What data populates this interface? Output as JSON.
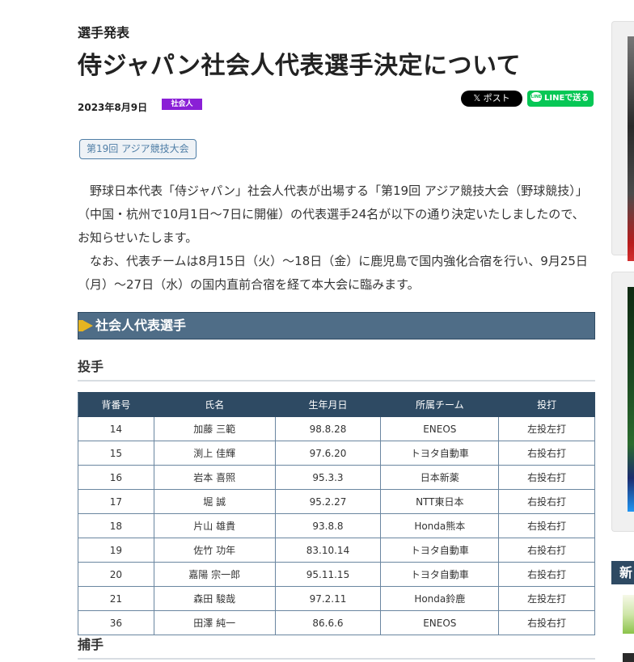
{
  "article": {
    "kicker": "選手発表",
    "title": "侍ジャパン社会人代表選手決定について",
    "date": "2023年8月9日",
    "category_badge": "社会人",
    "tag": "第19回 アジア競技大会",
    "paragraphs": [
      "野球日本代表「侍ジャパン」社会人代表が出場する「第19回 アジア競技大会（野球競技）」（中国・杭州で10月1日～7日に開催）の代表選手24名が以下の通り決定いたしましたので、お知らせいたします。",
      "なお、代表チームは8月15日（火）～18日（金）に鹿児島で国内強化合宿を行い、9月25日（月）～27日（水）の国内直前合宿を経て本大会に臨みます。"
    ]
  },
  "share": {
    "x_label": "𝕏 ポスト",
    "line_label": "LINEで送る",
    "line_bubble": "LINE"
  },
  "section": {
    "title": "社会人代表選手",
    "pitchers_heading": "投手",
    "catchers_heading": "捕手"
  },
  "table": {
    "headers": [
      "背番号",
      "氏名",
      "生年月日",
      "所属チーム",
      "投打"
    ],
    "rows": [
      [
        "14",
        "加藤 三範",
        "98.8.28",
        "ENEOS",
        "左投左打"
      ],
      [
        "15",
        "渕上 佳輝",
        "97.6.20",
        "トヨタ自動車",
        "右投右打"
      ],
      [
        "16",
        "岩本 喜照",
        "95.3.3",
        "日本新薬",
        "右投右打"
      ],
      [
        "17",
        "堀 誠",
        "95.2.27",
        "NTT東日本",
        "右投右打"
      ],
      [
        "18",
        "片山 雄貴",
        "93.8.8",
        "Honda熊本",
        "右投右打"
      ],
      [
        "19",
        "佐竹 功年",
        "83.10.14",
        "トヨタ自動車",
        "右投右打"
      ],
      [
        "20",
        "嘉陽 宗一郎",
        "95.11.15",
        "トヨタ自動車",
        "右投右打"
      ],
      [
        "21",
        "森田 駿哉",
        "97.2.11",
        "Honda鈴鹿",
        "左投左打"
      ],
      [
        "36",
        "田澤 純一",
        "86.6.6",
        "ENEOS",
        "右投右打"
      ]
    ]
  },
  "sidebar": {
    "heading_fragment": "新"
  },
  "colors": {
    "category_badge": "#8a1fd6",
    "section_bar": "#4f6d87",
    "table_header": "#2e4a63",
    "line_green": "#06c755",
    "tag_border": "#4f7ea6"
  }
}
